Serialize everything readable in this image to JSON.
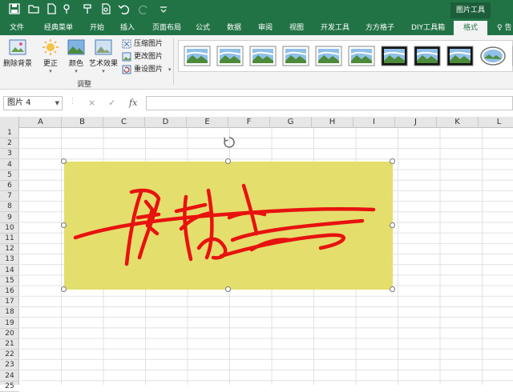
{
  "quick_access": {
    "icons": [
      "save-icon",
      "open-folder-icon",
      "new-file-icon",
      "touch-mode-icon",
      "format-painter-icon",
      "print-preview-icon",
      "undo-icon",
      "redo-icon",
      "customize-icon"
    ]
  },
  "context_tab_title": "图片工具",
  "tabs": [
    {
      "label": "文件"
    },
    {
      "label": "经典菜单"
    },
    {
      "label": "开始"
    },
    {
      "label": "插入"
    },
    {
      "label": "页面布局"
    },
    {
      "label": "公式"
    },
    {
      "label": "数据"
    },
    {
      "label": "审阅"
    },
    {
      "label": "视图"
    },
    {
      "label": "开发工具"
    },
    {
      "label": "方方格子"
    },
    {
      "label": "DIY工具箱"
    },
    {
      "label": "格式",
      "active": true
    },
    {
      "label": "♀ 告"
    }
  ],
  "ribbon": {
    "remove_bg": "删除背景",
    "corrections": "更正",
    "color": "颜色",
    "artistic": "艺术效果",
    "compress": "压缩图片",
    "change": "更改图片",
    "reset": "重设图片",
    "group_label": "调整",
    "picture_styles_count": 11
  },
  "formula_bar": {
    "name_box": "图片 4",
    "cancel_icon": "×",
    "enter_icon": "✓",
    "fx_label": "fx",
    "value": ""
  },
  "grid": {
    "columns": [
      "A",
      "B",
      "C",
      "D",
      "E",
      "F",
      "G",
      "H",
      "I",
      "J",
      "K",
      "L"
    ],
    "rows": [
      "1",
      "2",
      "3",
      "4",
      "5",
      "6",
      "7",
      "8",
      "9",
      "10",
      "11",
      "12",
      "13",
      "14",
      "15",
      "16",
      "17",
      "18",
      "19",
      "20",
      "21",
      "22",
      "23",
      "24",
      "25"
    ]
  },
  "picture": {
    "background": "#e4de6c",
    "signature_color": "#e8120f"
  },
  "colors": {
    "excel_green": "#217346",
    "ribbon_bg": "#f3f3f3"
  }
}
